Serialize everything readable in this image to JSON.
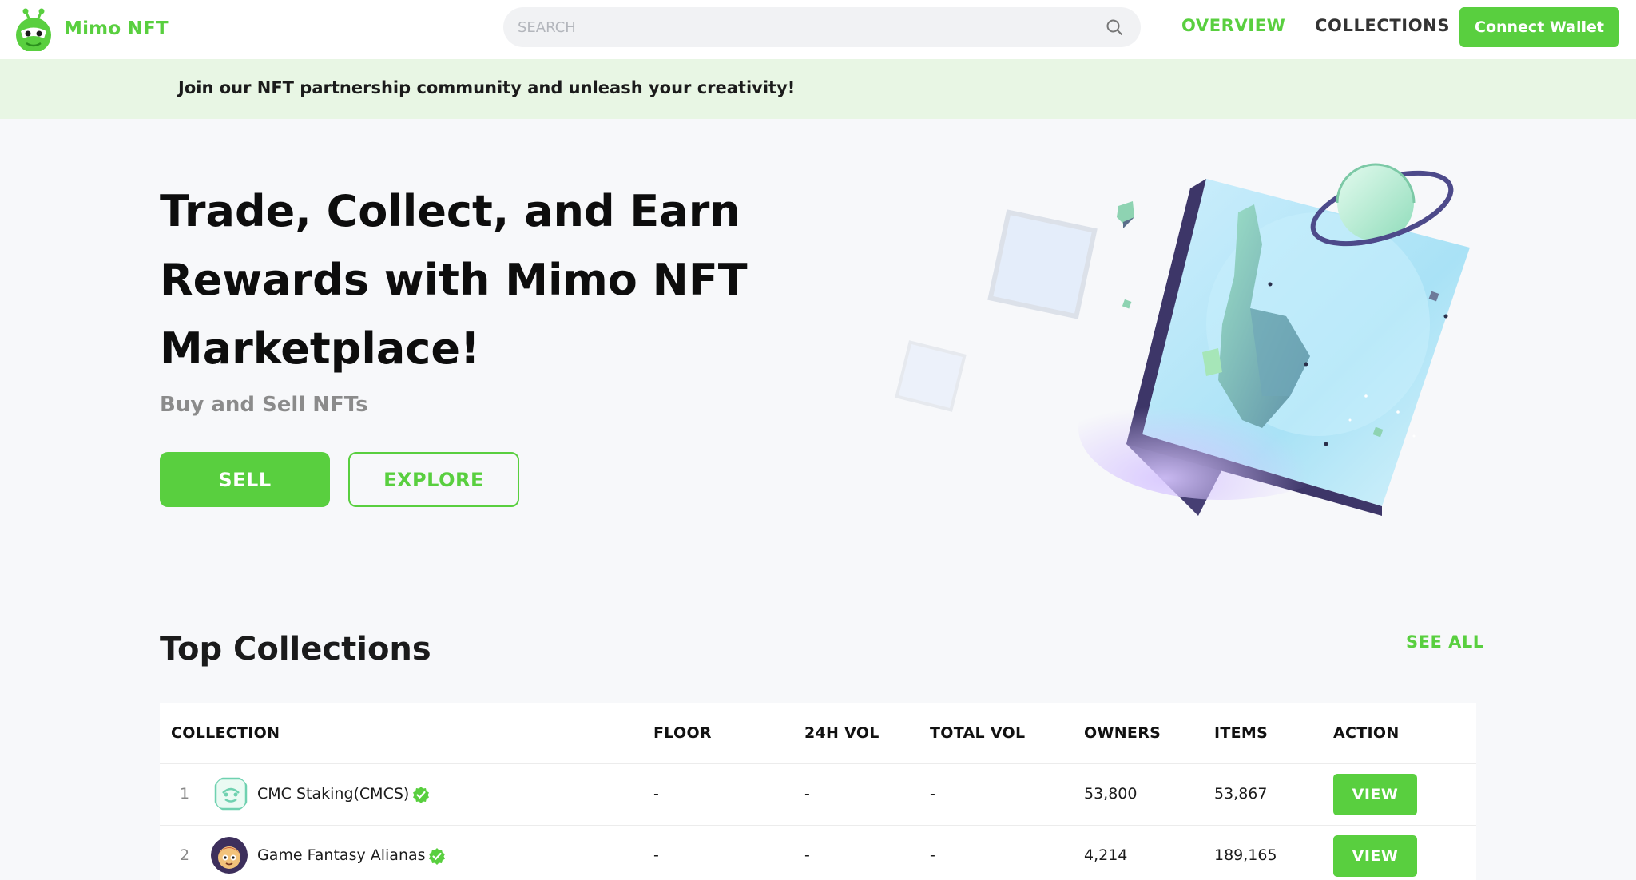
{
  "header": {
    "brand": "Mimo NFT",
    "search": {
      "placeholder": "SEARCH",
      "value": ""
    },
    "nav": {
      "overview": "OVERVIEW",
      "collections": "COLLECTIONS"
    },
    "connect_wallet": "Connect Wallet"
  },
  "banner": {
    "text": "Join our NFT partnership community and unleash your creativity!"
  },
  "hero": {
    "title": "Trade, Collect, and Earn Rewards with Mimo NFT Marketplace!",
    "subtitle": "Buy and Sell NFTs",
    "sell_label": "SELL",
    "explore_label": "EXPLORE"
  },
  "top_collections": {
    "title": "Top Collections",
    "see_all": "SEE ALL",
    "columns": [
      "COLLECTION",
      "FLOOR",
      "24H VOL",
      "TOTAL VOL",
      "OWNERS",
      "ITEMS",
      "ACTION"
    ],
    "rows": [
      {
        "rank": "1",
        "name": "CMC Staking(CMCS)",
        "floor": "-",
        "vol_24h": "-",
        "total_vol": "-",
        "owners": "53,800",
        "items": "53,867",
        "action": "VIEW"
      },
      {
        "rank": "2",
        "name": "Game Fantasy Alianas",
        "floor": "-",
        "vol_24h": "-",
        "total_vol": "-",
        "owners": "4,214",
        "items": "189,165",
        "action": "VIEW"
      }
    ]
  },
  "colors": {
    "accent": "#59cf3f",
    "banner_bg": "#e8f6e4",
    "page_bg": "#f7f8fa"
  }
}
